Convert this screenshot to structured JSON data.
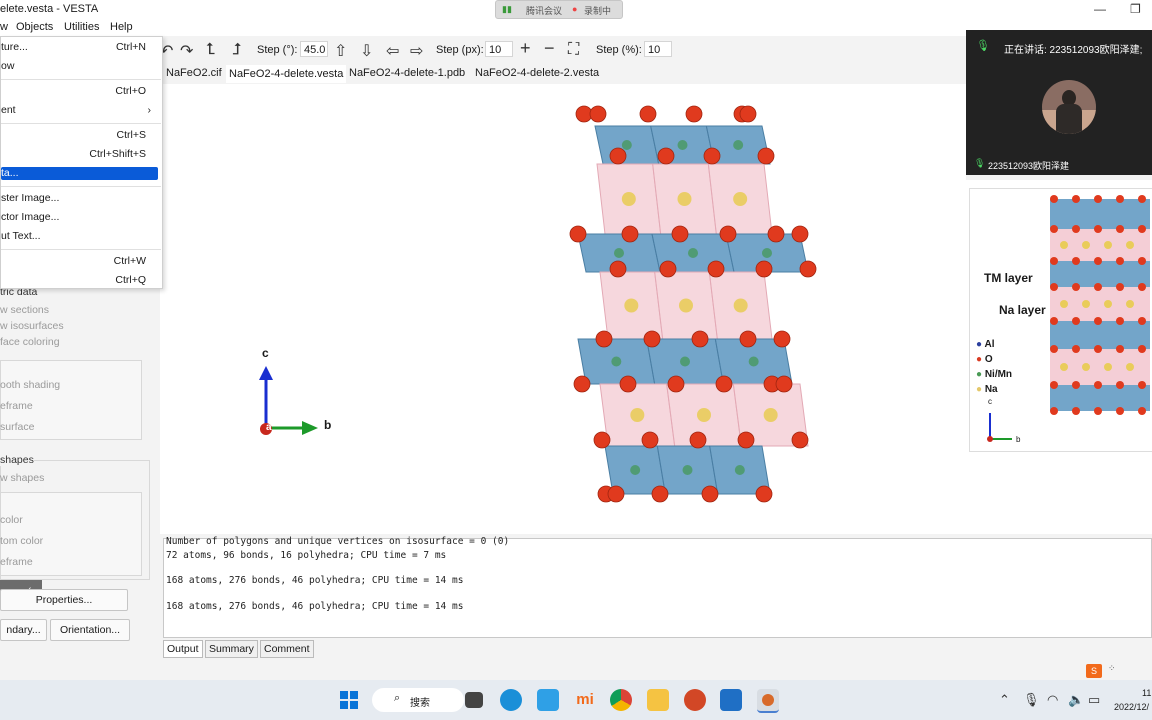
{
  "window": {
    "title": "elete.vesta - VESTA"
  },
  "meeting": {
    "app": "腾讯会议",
    "recording": "录制中"
  },
  "menubar": [
    "w",
    "Objects",
    "Utilities",
    "Help"
  ],
  "dropdown": {
    "items": [
      {
        "label": "ture...",
        "shortcut": "Ctrl+N"
      },
      {
        "label": "ow",
        "shortcut": ""
      },
      {
        "label": "",
        "shortcut": "Ctrl+O"
      },
      {
        "label": "ent",
        "shortcut": "›"
      },
      {
        "label": "",
        "shortcut": "Ctrl+S"
      },
      {
        "label": "",
        "shortcut": "Ctrl+Shift+S"
      },
      {
        "label": "ta...",
        "shortcut": ""
      },
      {
        "label": "ster Image...",
        "shortcut": ""
      },
      {
        "label": "ctor Image...",
        "shortcut": ""
      },
      {
        "label": "ut Text...",
        "shortcut": ""
      },
      {
        "label": "",
        "shortcut": "Ctrl+W"
      },
      {
        "label": "",
        "shortcut": "Ctrl+Q"
      }
    ]
  },
  "toolbar": {
    "step_deg_label": "Step (°):",
    "step_deg_value": "45.0",
    "step_px_label": "Step (px):",
    "step_px_value": "10",
    "step_pct_label": "Step (%):",
    "step_pct_value": "10"
  },
  "tabs": [
    "NaFeO2.cif",
    "NaFeO2-4-delete.vesta",
    "NaFeO2-4-delete-1.pdb",
    "NaFeO2-4-delete-2.vesta"
  ],
  "axes": {
    "c": "c",
    "b": "b",
    "a": "a"
  },
  "leftpanel": {
    "header1": "tric data",
    "items1": [
      "w sections",
      "w isosurfaces",
      "face coloring"
    ],
    "items2": [
      "ooth shading",
      "eframe",
      "surface"
    ],
    "header2": "shapes",
    "items3": [
      "w shapes"
    ],
    "items4": [
      "color",
      "tom color",
      "eframe"
    ],
    "collapse_label": "...",
    "properties_button": "Properties...",
    "boundary_button": "ndary...",
    "orientation_button": "Orientation..."
  },
  "output": {
    "lines": [
      "Number of polygons and unique vertices on isosurface = 0 (0)",
      "72 atoms, 96 bonds, 16 polyhedra; CPU time = 7 ms",
      "168 atoms, 276 bonds, 46 polyhedra; CPU time = 14 ms",
      "168 atoms, 276 bonds, 46 polyhedra; CPU time = 14 ms"
    ],
    "tabs": [
      "Output",
      "Summary",
      "Comment"
    ]
  },
  "video": {
    "speaking": "正在讲话: 223512093欧阳泽建;",
    "participant": "223512093欧阳泽建"
  },
  "reference": {
    "tm_layer": "TM layer",
    "na_layer": "Na layer",
    "legend": [
      {
        "label": "Al",
        "color": "#2b3f9e"
      },
      {
        "label": "O",
        "color": "#d93b22"
      },
      {
        "label": "Ni/Mn",
        "color": "#4a9a55"
      },
      {
        "label": "Na",
        "color": "#e4c86a"
      }
    ],
    "axis_c": "c",
    "axis_b": "b"
  },
  "taskbar": {
    "search": "搜索",
    "time": "11",
    "date": "2022/12/"
  },
  "colors": {
    "oxygen": "#e03a1e",
    "tm_octahedra": "#5b95c0",
    "na_octahedra": "#f2c6cf",
    "na_atom": "#e9cc5a",
    "tm_atom": "#4c9a6a",
    "highlight": "#0a5bd8"
  }
}
